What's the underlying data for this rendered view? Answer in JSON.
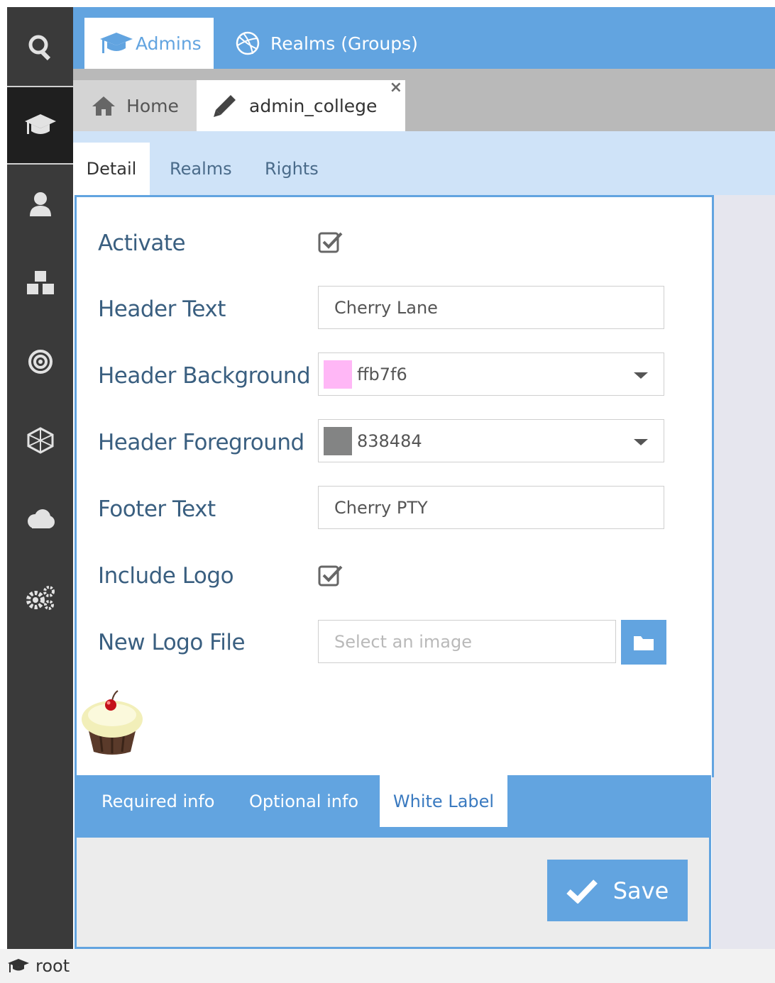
{
  "top_tabs": [
    {
      "label": "Admins",
      "icon": "graduation-cap-icon",
      "active": true
    },
    {
      "label": "Realms (Groups)",
      "icon": "dribbble-icon",
      "active": false
    }
  ],
  "doc_tabs": [
    {
      "label": "Home",
      "icon": "home-icon"
    },
    {
      "label": "admin_college",
      "icon": "pencil-icon",
      "close": "×"
    }
  ],
  "sub_tabs": [
    "Detail",
    "Realms",
    "Rights"
  ],
  "sidebar": {
    "items": [
      "search-icon",
      "graduation-cap-icon",
      "user-icon",
      "cubes-icon",
      "bullseye-icon",
      "hexagon-mesh-icon",
      "cloud-icon",
      "gears-icon"
    ],
    "active_index": 1
  },
  "form": {
    "activate": {
      "label": "Activate",
      "checked": true
    },
    "header_text": {
      "label": "Header Text",
      "value": "Cherry Lane"
    },
    "header_background": {
      "label": "Header Background",
      "value": "ffb7f6",
      "color": "#ffb7f6"
    },
    "header_foreground": {
      "label": "Header Foreground",
      "value": "838484",
      "color": "#838484"
    },
    "footer_text": {
      "label": "Footer Text",
      "value": "Cherry PTY"
    },
    "include_logo": {
      "label": "Include Logo",
      "checked": true
    },
    "new_logo_file": {
      "label": "New Logo File",
      "placeholder": "Select an image"
    }
  },
  "bottom_tabs": [
    "Required info",
    "Optional info",
    "White Label"
  ],
  "save_label": "Save",
  "status": {
    "user": "root"
  },
  "colors": {
    "accent": "#62a4e0",
    "sidebar": "#3a3a3a"
  }
}
